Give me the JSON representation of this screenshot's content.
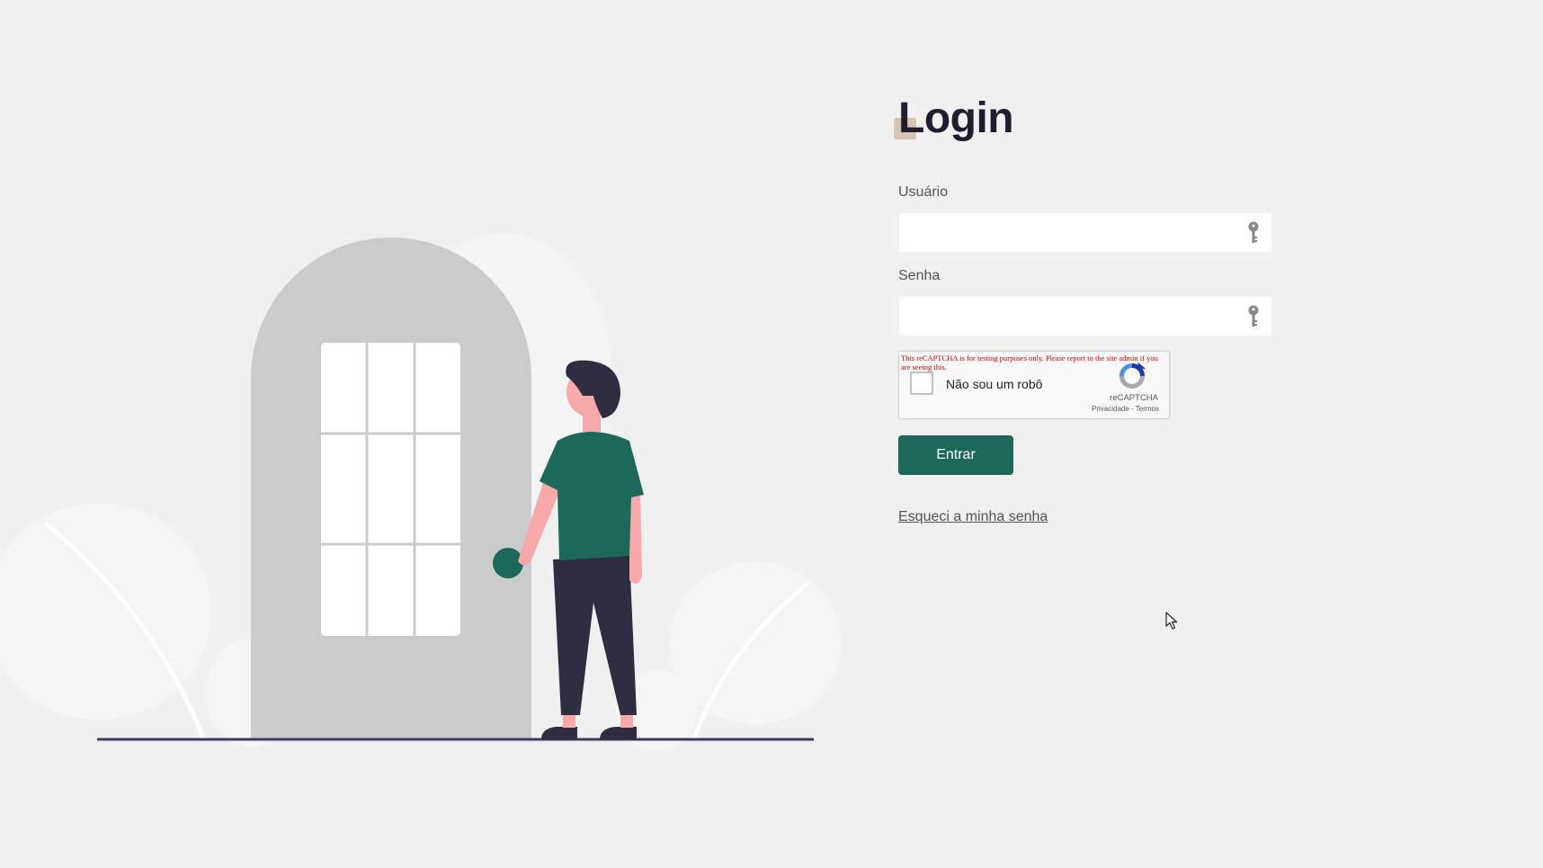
{
  "login": {
    "title": "Login",
    "username_label": "Usuário",
    "username_value": "",
    "password_label": "Senha",
    "password_value": "",
    "submit_label": "Entrar",
    "forgot_link": "Esqueci a minha senha"
  },
  "recaptcha": {
    "warning": "This reCAPTCHA is for testing purposes only. Please report to the site admin if you are seeing this.",
    "checkbox_label": "Não sou um robô",
    "brand": "reCAPTCHA",
    "privacy": "Privacidade",
    "separator": " - ",
    "terms": "Termos"
  },
  "icons": {
    "field_icon": "key-icon",
    "recaptcha_logo": "recaptcha-logo-icon",
    "cursor": "mouse-pointer-icon"
  },
  "colors": {
    "background": "#f0f0f0",
    "primary_button": "#1d6959",
    "title": "#1e1e2e",
    "person_shirt": "#1d6959",
    "person_pants": "#2f2e41",
    "skin": "#f7a8a8",
    "door": "#cbcbcb"
  }
}
